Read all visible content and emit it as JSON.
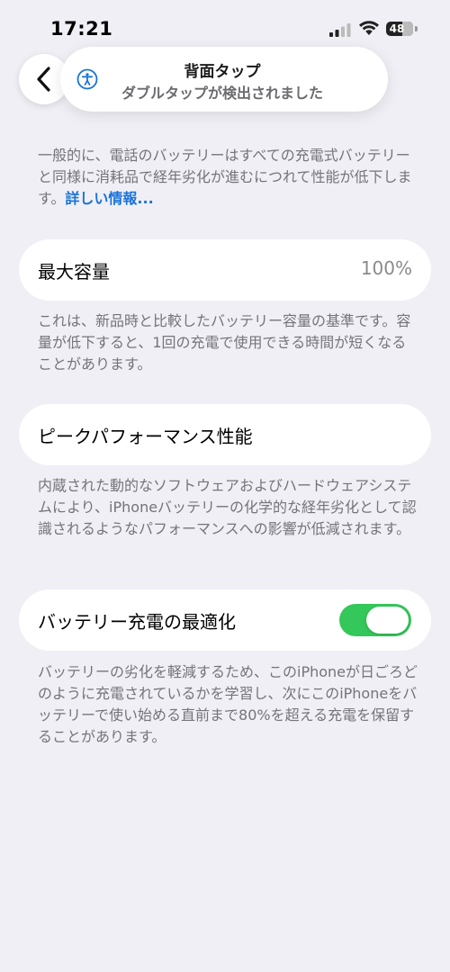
{
  "status_bar": {
    "time": "17:21",
    "battery_level": "48"
  },
  "toast": {
    "title": "背面タップ",
    "subtitle": "ダブルタップが検出されました"
  },
  "intro": {
    "text": "一般的に、電話のバッテリーはすべての充電式バッテリーと同様に消耗品で経年劣化が進むにつれて性能が低下します。",
    "link": "詳しい情報..."
  },
  "max_capacity": {
    "label": "最大容量",
    "value": "100%",
    "description": "これは、新品時と比較したバッテリー容量の基準です。容量が低下すると、1回の充電で使用できる時間が短くなることがあります。"
  },
  "peak_performance": {
    "label": "ピークパフォーマンス性能",
    "description": "内蔵された動的なソフトウェアおよびハードウェアシステムにより、iPhoneバッテリーの化学的な経年劣化として認識されるようなパフォーマンスへの影響が低減されます。"
  },
  "charging_optimization": {
    "label": "バッテリー充電の最適化",
    "enabled": true,
    "description": "バッテリーの劣化を軽減するため、このiPhoneが日ごろどのように充電されているかを学習し、次にこのiPhoneをバッテリーで使い始める直前まで80%を超える充電を保留することがあります。"
  },
  "colors": {
    "background": "#f0eff5",
    "link": "#1a73d9",
    "toggle_on": "#34c759",
    "secondary_text": "#74747a"
  }
}
